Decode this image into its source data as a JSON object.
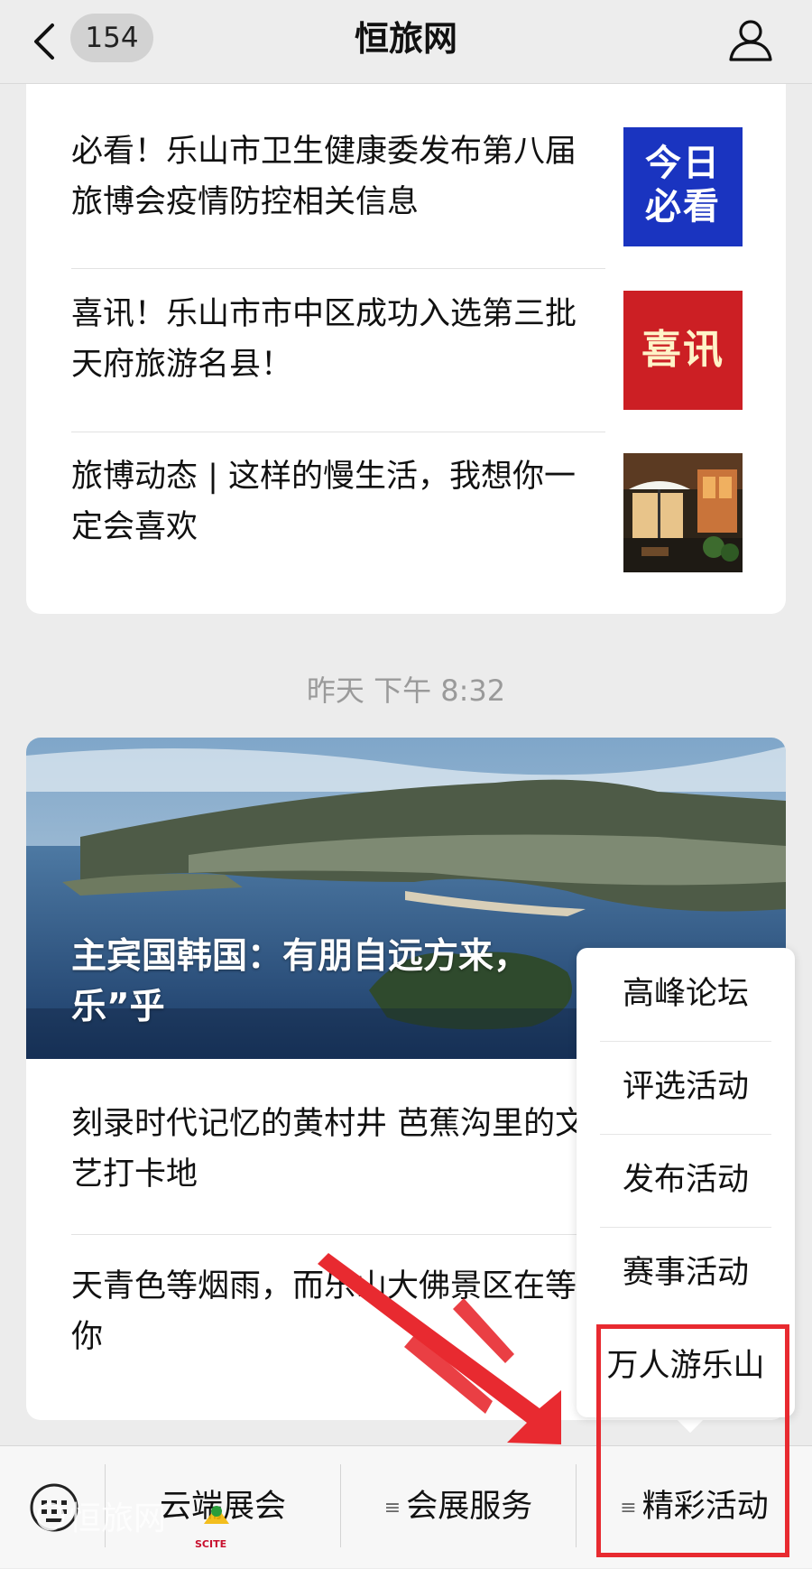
{
  "header": {
    "back_count": "154",
    "title": "恒旅网"
  },
  "feed": {
    "group1": [
      {
        "title": "必看！乐山市卫生健康委发布第八届旅博会疫情防控相关信息",
        "thumb_text": "今日\n必看",
        "thumb_color": "#1a34c0"
      },
      {
        "title": "喜讯！乐山市市中区成功入选第三批天府旅游名县！",
        "thumb_text": "喜讯",
        "thumb_color": "#cc1f24"
      },
      {
        "title": "旅博动态 | 这样的慢生活，我想你一定会喜欢",
        "thumb_icon": "cafe-photo"
      }
    ],
    "timestamp": "昨天 下午 8:32",
    "group2": {
      "hero_title": "主宾国韩国：有朋自远方来，不亦“乐”乎",
      "hero_visible": "主宾国韩国：有朋自远方来，",
      "hero_visible_line2": "乐”乎",
      "articles": [
        {
          "title": "刻录时代记忆的黄村井 芭蕉沟里的文艺打卡地"
        },
        {
          "title": "天青色等烟雨，而乐山大佛景区在等你"
        }
      ]
    }
  },
  "popup_menu": {
    "items": [
      "高峰论坛",
      "评选活动",
      "发布活动",
      "赛事活动",
      "万人游乐山"
    ]
  },
  "bottom_menu": {
    "items": [
      "云端展会",
      "会展服务",
      "精彩活动"
    ],
    "watermark_text": "恒旅网",
    "logo_text": "SCITE"
  },
  "colors": {
    "accent_red": "#e82a30",
    "background": "#ececec"
  }
}
